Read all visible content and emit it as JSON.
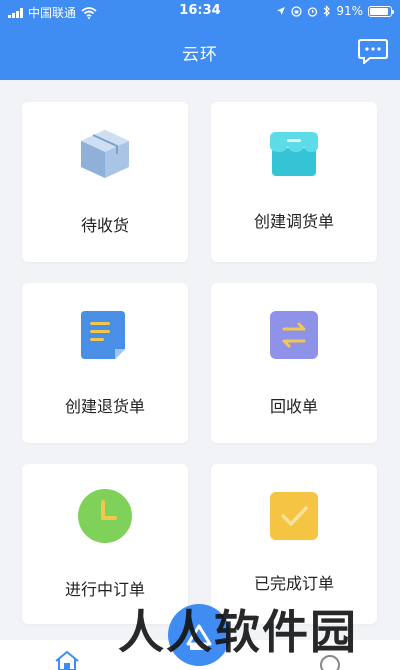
{
  "status_bar": {
    "carrier": "中国联通",
    "time": "16:34",
    "battery": "91%"
  },
  "header": {
    "title": "云环",
    "message_icon": "message-icon"
  },
  "cards": [
    {
      "label": "待收货",
      "icon": "box-icon"
    },
    {
      "label": "创建调货单",
      "icon": "store-icon"
    },
    {
      "label": "创建退货单",
      "icon": "document-icon"
    },
    {
      "label": "回收单",
      "icon": "exchange-icon"
    },
    {
      "label": "进行中订单",
      "icon": "clock-icon"
    },
    {
      "label": "已完成订单",
      "icon": "check-icon"
    }
  ],
  "tabbar": {
    "home_icon": "home-icon",
    "center_icon": "dashboard-icon",
    "profile_icon": "profile-icon"
  },
  "watermark": "人人软件园"
}
